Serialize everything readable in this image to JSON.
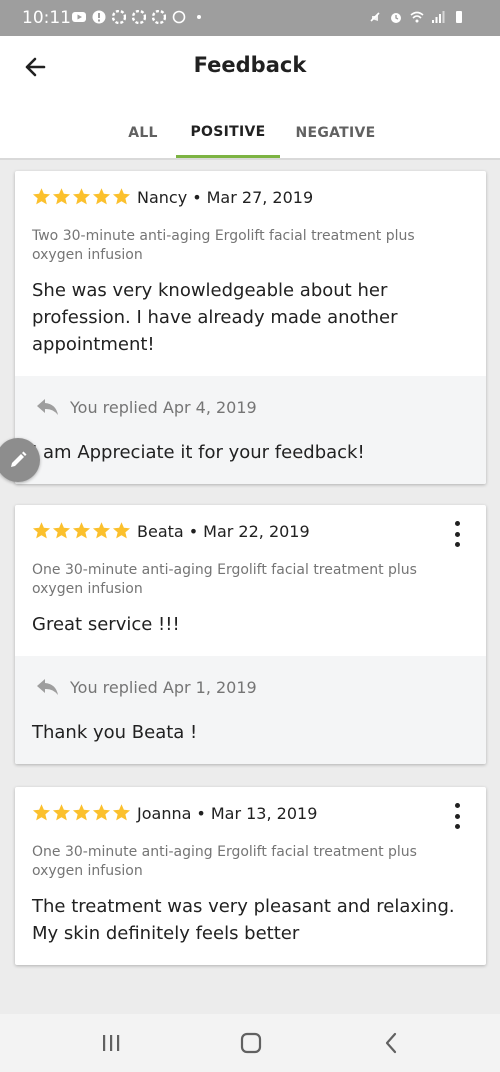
{
  "status_bar": {
    "time": "10:11"
  },
  "header": {
    "title": "Feedback",
    "back_icon": "arrow-left-icon"
  },
  "tabs": [
    {
      "label": "ALL",
      "active": false
    },
    {
      "label": "POSITIVE",
      "active": true
    },
    {
      "label": "NEGATIVE",
      "active": false
    }
  ],
  "colors": {
    "accent": "#7cb342",
    "star": "#fbc02d",
    "reply_bg": "#f4f5f6"
  },
  "reviews": [
    {
      "rating": 5,
      "name": "Nancy",
      "separator": "•",
      "date": "Mar 27, 2019",
      "service": "Two 30-minute anti-aging Ergolift facial treatment plus oxygen infusion",
      "comment": "She was very knowledgeable about her profession.  I have already made another appointment!",
      "reply_meta": "You replied Apr 4, 2019",
      "reply": "I am Appreciate it for your feedback!"
    },
    {
      "rating": 5,
      "name": "Beata",
      "separator": "•",
      "date": "Mar 22, 2019",
      "service": "One 30-minute anti-aging Ergolift facial treatment plus oxygen infusion",
      "comment": "Great service !!!",
      "reply_meta": "You replied Apr 1, 2019",
      "reply": "Thank you Beata !"
    },
    {
      "rating": 5,
      "name": "Joanna",
      "separator": "•",
      "date": "Mar 13, 2019",
      "service": "One 30-minute anti-aging Ergolift facial treatment plus oxygen infusion",
      "comment": "The treatment was very pleasant and relaxing. My skin definitely feels better"
    }
  ],
  "nav_bar": {
    "recents_icon": "recents-icon",
    "home_icon": "home-icon",
    "back_icon": "nav-back-icon"
  }
}
